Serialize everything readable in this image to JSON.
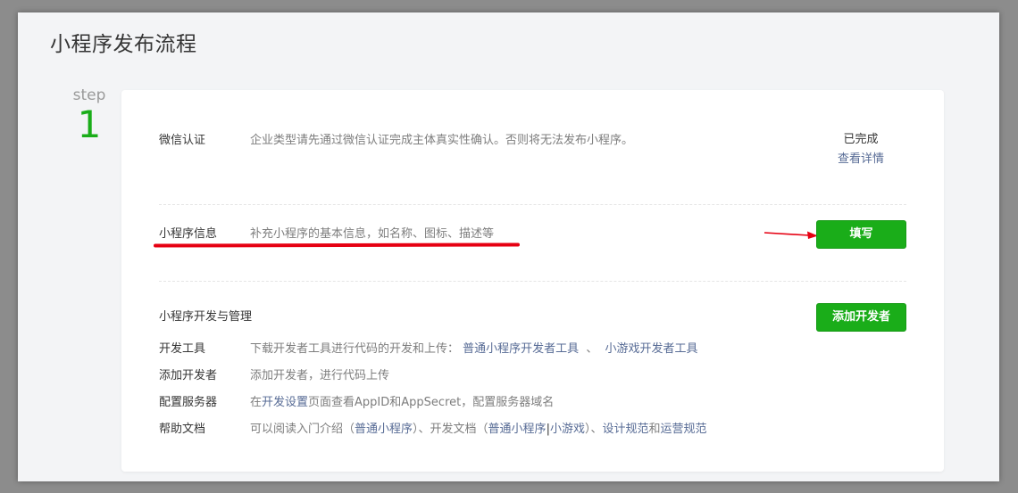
{
  "page_title": "小程序发布流程",
  "step": {
    "word": "step",
    "number": "1"
  },
  "wechat_auth": {
    "label": "微信认证",
    "desc": "企业类型请先通过微信认证完成主体真实性确认。否则将无法发布小程序。",
    "status": "已完成",
    "detail_link": "查看详情"
  },
  "mini_info": {
    "label": "小程序信息",
    "desc": "补充小程序的基本信息，如名称、图标、描述等",
    "button": "填写"
  },
  "dev_manage": {
    "title": "小程序开发与管理",
    "button": "添加开发者",
    "rows": [
      {
        "label": "开发工具",
        "desc_prefix": "下载开发者工具进行代码的开发和上传：",
        "link1": "普通小程序开发者工具",
        "sep": "、",
        "link2": "小游戏开发者工具"
      },
      {
        "label": "添加开发者",
        "desc": "添加开发者，进行代码上传"
      },
      {
        "label": "配置服务器",
        "desc_prefix": "在",
        "link": "开发设置",
        "desc_suffix": "页面查看AppID和AppSecret，配置服务器域名"
      },
      {
        "label": "帮助文档",
        "t1": "可以阅读入门介绍（",
        "l1": "普通小程序",
        "t2": "）、开发文档（",
        "l2": "普通小程序",
        "t3": "|",
        "l3": "小游戏",
        "t4": "）、",
        "l4": "设计规范",
        "t5": "和",
        "l5": "运营规范"
      }
    ]
  },
  "colors": {
    "accent_green": "#1aad19",
    "link_blue": "#576b95",
    "annotation_red": "#e60012"
  }
}
